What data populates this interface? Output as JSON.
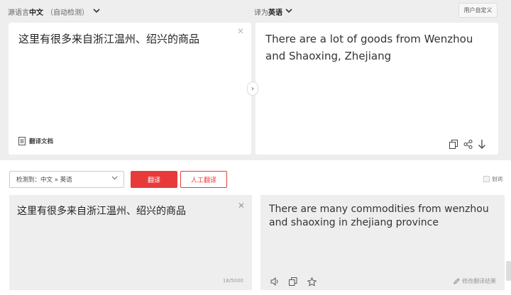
{
  "top": {
    "source_lang_prefix": "源语言",
    "source_lang": "中文",
    "source_lang_note": "（自动检测）",
    "target_lang_prefix": "译为",
    "target_lang": "英语",
    "user_dict_label": "用户自定义",
    "source_text": "这里有很多来自浙江温州、绍兴的商品",
    "target_text": "There are a lot of goods from Wenzhou and Shaoxing, Zhejiang",
    "doc_translate_label": "翻译文档"
  },
  "bottom": {
    "detect_label": "检测到：中文 » 英语",
    "translate_label": "翻译",
    "human_translate_label": "人工翻译",
    "word_label": "划词",
    "source_text": "这里有很多来自浙江温州、绍兴的商品",
    "char_count": "18/5000",
    "target_text": "There are many commodities from wenzhou and shaoxing in zhejiang province",
    "edit_label": "修改翻译结果"
  },
  "colors": {
    "accent_red": "#e83a3a",
    "page_bg": "#eeeeee"
  },
  "icons": [
    "chevron-down-icon",
    "close-icon",
    "document-icon",
    "swap-arrow-icon",
    "copy-icon",
    "share-icon",
    "download-icon",
    "speaker-icon",
    "star-icon",
    "pencil-icon"
  ]
}
